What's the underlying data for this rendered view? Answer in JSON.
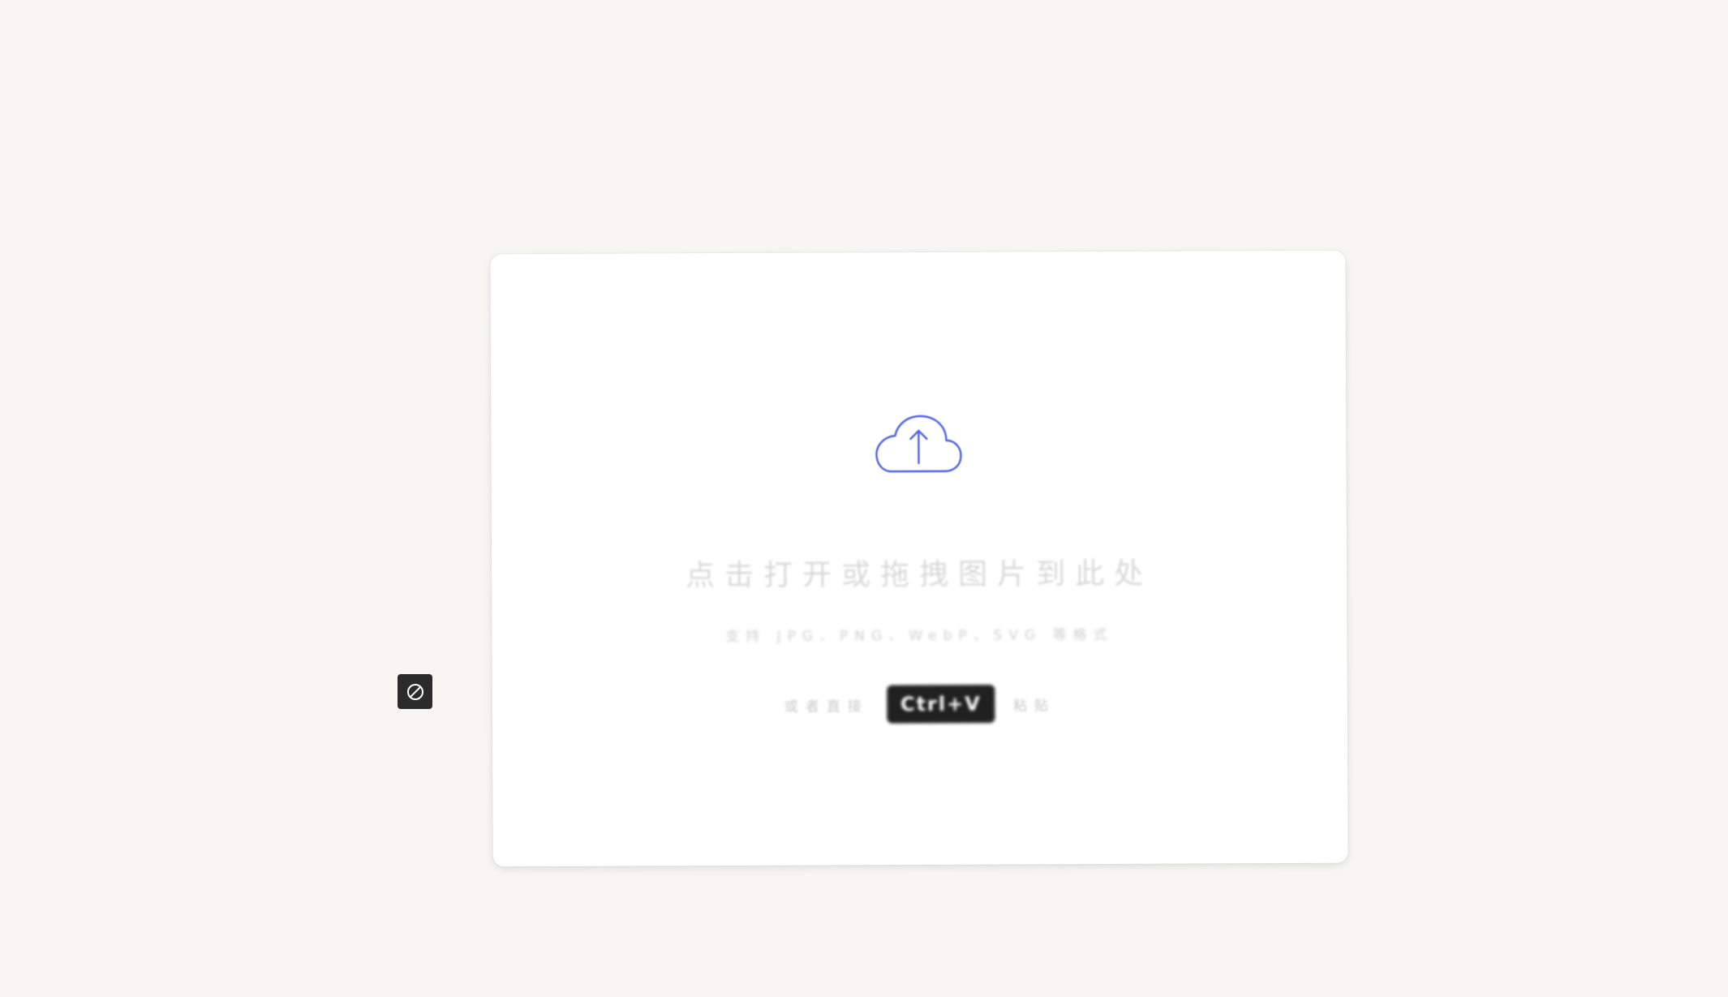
{
  "dropzone": {
    "title": "点击打开或拖拽图片到此处",
    "formats": "支持 JPG、PNG、WebP、SVG 等格式",
    "paste_prefix": "或者直接",
    "shortcut": "Ctrl+V",
    "paste_suffix": "粘贴"
  },
  "icons": {
    "upload": "cloud-upload-icon",
    "toggle": "block-icon"
  },
  "colors": {
    "background": "#f7f6f2",
    "accent": "#4f63e0",
    "badge": "#202020"
  }
}
